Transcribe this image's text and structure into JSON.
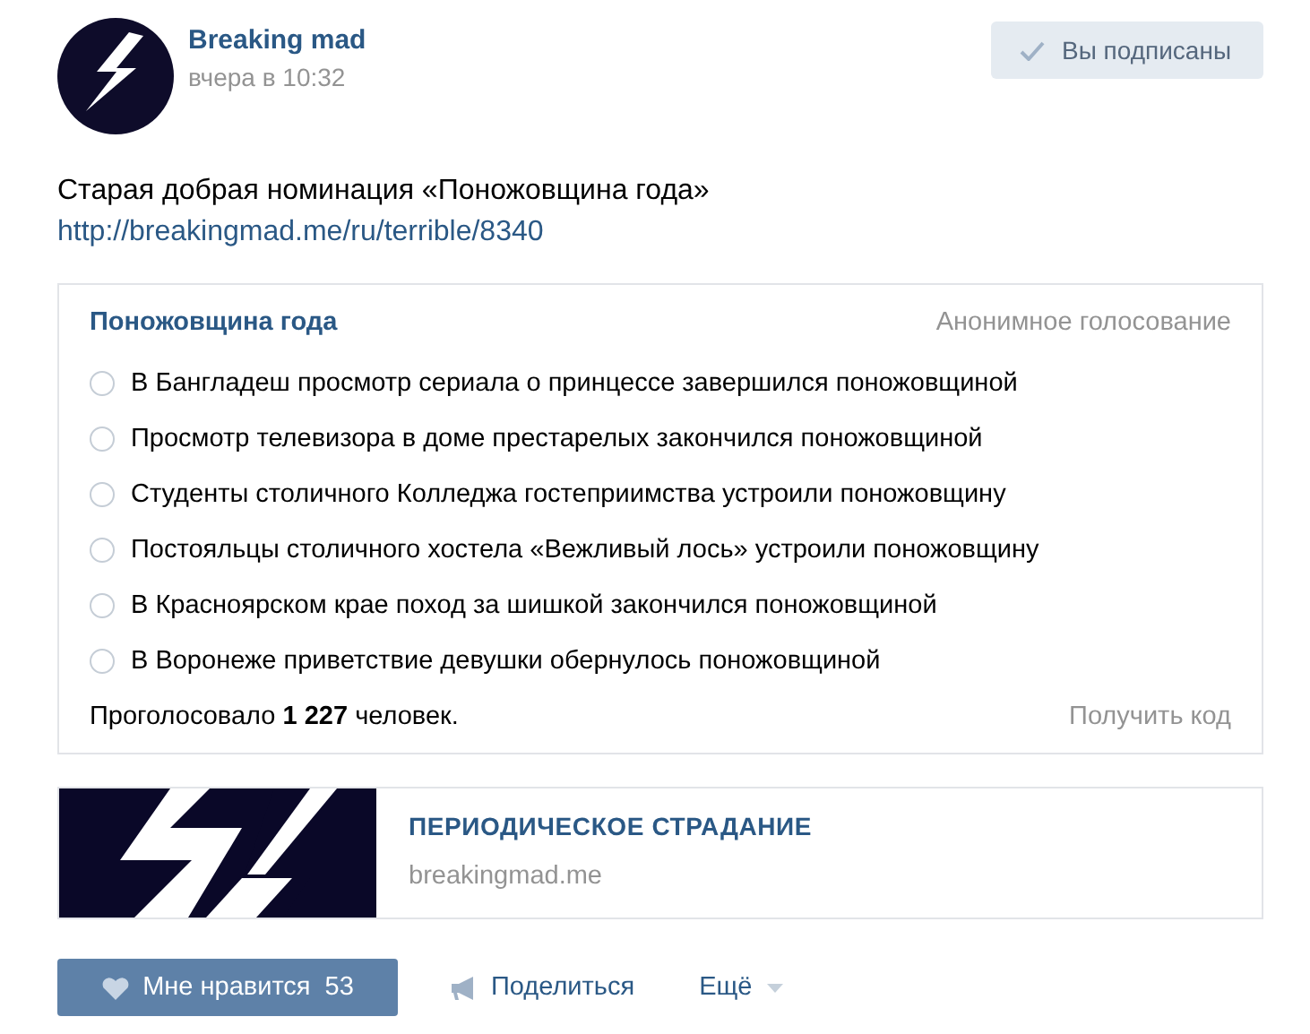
{
  "post": {
    "author": "Breaking mad",
    "time": "вчера в 10:32",
    "subscribe": {
      "label": "Вы подписаны",
      "subscribed": true
    },
    "text": "Старая добрая номинация «Поножовщина года»",
    "link": "http://breakingmad.me/ru/terrible/8340"
  },
  "poll": {
    "title": "Поножовщина года",
    "type": "Анонимное голосование",
    "options": [
      {
        "label": "В Бангладеш просмотр сериала о принцессе завершился поножовщиной",
        "selected": false
      },
      {
        "label": "Просмотр телевизора в доме престарелых закончился поножовщиной",
        "selected": false
      },
      {
        "label": "Студенты столичного Колледжа гостеприимства устроили поножовщину",
        "selected": false
      },
      {
        "label": "Постояльцы столичного хостела «Вежливый лось» устроили поножовщину",
        "selected": false
      },
      {
        "label": "В Красноярском крае поход за шишкой закончился поножовщиной",
        "selected": false
      },
      {
        "label": "В Воронеже приветствие девушки обернулось поножовщиной",
        "selected": false
      }
    ],
    "votes": "Проголосовало **1 227** человек.",
    "code_link": "Получить код"
  },
  "link_card": {
    "title": "ПЕРИОДИЧЕСКОЕ СТРАДАНИЕ",
    "domain": "breakingmad.me"
  },
  "actions": {
    "like": {
      "label": "Мне нравится",
      "count": "53",
      "liked": true
    },
    "share": "Поделиться",
    "more": "Ещё"
  }
}
